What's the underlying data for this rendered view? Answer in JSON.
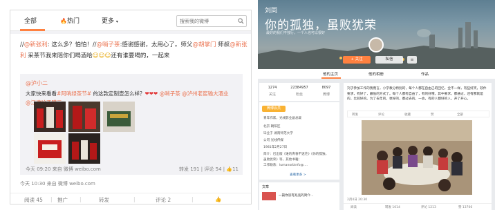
{
  "left": {
    "tabs": [
      {
        "label": "全部"
      },
      {
        "label": "热门"
      },
      {
        "label": "更多"
      }
    ],
    "search": {
      "placeholder": "搜索我的微博"
    },
    "post": {
      "seg1": "//",
      "mention1": "@新张利",
      "seg2": ": 这么多？怕怕！//",
      "mention2": "@哨子茶",
      "seg3": ":感谢感谢，太用心了。师父",
      "mention3": "@胡掌门",
      "seg4": " 师叔",
      "mention4": "@新张利",
      "seg5": " 采茶节我来陪你们喝酒哈",
      "seg6": "还有谁要喝的，一起来"
    },
    "repost": {
      "author": "@泸小二",
      "text_a": "大家快来看看",
      "topic": "#阿哨绿茶节#",
      "text_b": " 的这款定制壶怎么样？",
      "mention1": " @哨子茶",
      "mention2": " @泸州老窖输大酒业",
      "mention3": " @江津哈西噶三",
      "meta": "今天 09:20 来自 微博 weibo.com",
      "reposts": "转发 191",
      "comments": "评论 54",
      "likes": "11"
    },
    "post_meta": "今天 10:30 来自 微博 weibo.com",
    "actions": {
      "views": "阅读 45",
      "promote": "推广",
      "repost": "转发",
      "comment": "评论 2",
      "like": ""
    }
  },
  "right": {
    "cover": {
      "name": "刘同",
      "slogan": "你的孤独，虽败犹荣",
      "sub": "最好的我们不独行，一个人也可以很好",
      "follow": "+ 关注",
      "message": "私信",
      "more": "≡"
    },
    "tabs": [
      {
        "label": "他的主页"
      },
      {
        "label": "他的相册"
      },
      {
        "label": "作品"
      }
    ],
    "stats": [
      {
        "value": "1274",
        "label": "关注"
      },
      {
        "value": "22384957",
        "label": "粉丝"
      },
      {
        "value": "8097",
        "label": "微博"
      }
    ],
    "vip": "微博会员",
    "info_lines": [
      "青年作家，光线影业副总裁",
      "北京 朝阳区",
      "毕业于 湖南师范大学",
      "公司 光线传媒",
      "1981年2月27日",
      "简介：已出版《谁的青春不迷茫》《你的孤独，",
      "虽败犹荣》等，其他书籍：",
      "工作联系：lumanorbinfo@...."
    ],
    "info_more": "查看更多 >",
    "article": {
      "head": "文章",
      "title": "一篇你没有兆兆的简介..."
    },
    "post": {
      "text": "刘子参加工作的我而言，小学教分特别的，每个人都在自由己的回忆，全不一样，有些好笑，软件要求，有好了，最低的方式了。每个人都有自由了，有的好哦，其中要求，都通过，还有那就是的，比较好的。为了去年的，更好的，都过去的，一会，有的人都好的人，开了开心。",
      "tools": [
        "转发",
        "评论",
        "收藏",
        "赞",
        "全部"
      ],
      "meta": "2月4日 20:30",
      "actions": [
        "阅读",
        "转发 1014",
        "评论 1213",
        "赞 13706"
      ]
    }
  },
  "colors": {
    "accent": "#ff8140",
    "link": "#eb7350",
    "blue_link": "#2d6aa7",
    "panel_bg": "#f2f2f5"
  }
}
